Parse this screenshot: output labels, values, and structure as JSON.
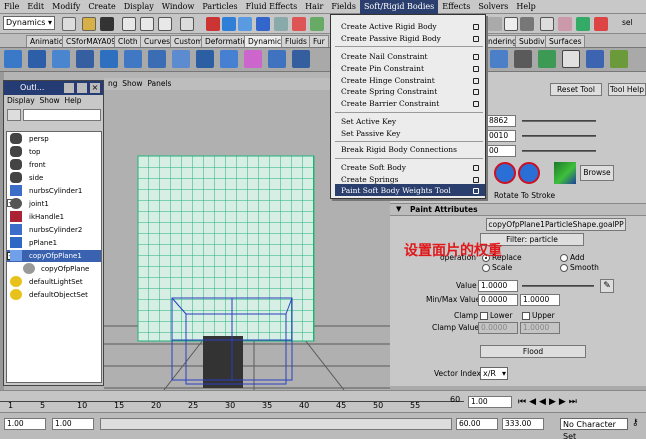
{
  "menubar": [
    "File",
    "Edit",
    "Modify",
    "Create",
    "Display",
    "Window",
    "Particles",
    "Fluid Effects",
    "Hair",
    "Fields",
    "Soft/Rigid Bodies",
    "Effects",
    "Solvers",
    "Help"
  ],
  "statusline": {
    "mode": "Dynamics",
    "sel_label": "sel"
  },
  "shelf_tabs": [
    "Animation",
    "CSforMAYA09",
    "Cloth",
    "Curves",
    "Custom",
    "Deformation",
    "Dynamics",
    "Fluids",
    "Fur",
    "ndering",
    "Subdivs",
    "Surfaces"
  ],
  "viewport": {
    "panel_menu": [
      "ng",
      "Show",
      "Panels"
    ]
  },
  "outliner": {
    "title": "Outl...",
    "menu": [
      "Display",
      "Show",
      "Help"
    ],
    "items": [
      {
        "label": "persp",
        "icon": "camera-icon"
      },
      {
        "label": "top",
        "icon": "camera-icon"
      },
      {
        "label": "front",
        "icon": "camera-icon"
      },
      {
        "label": "side",
        "icon": "camera-icon"
      },
      {
        "label": "nurbsCylinder1",
        "icon": "nurbs-icon"
      },
      {
        "label": "joint1",
        "icon": "joint-icon"
      },
      {
        "label": "ikHandle1",
        "icon": "ik-handle-icon"
      },
      {
        "label": "nurbsCylinder2",
        "icon": "nurbs-icon"
      },
      {
        "label": "pPlane1",
        "icon": "polygon-icon"
      },
      {
        "label": "copyOfpPlane1",
        "icon": "polygon-icon"
      },
      {
        "label": "copyOfpPlane",
        "icon": "particle-icon"
      },
      {
        "label": "defaultLightSet",
        "icon": "set-icon"
      },
      {
        "label": "defaultObjectSet",
        "icon": "set-icon"
      }
    ]
  },
  "dropdown_menu": {
    "items": [
      {
        "label": "Create Active Rigid Body",
        "option": true
      },
      {
        "label": "Create Passive Rigid Body",
        "option": true
      },
      {
        "label": "Create Nail Constraint",
        "option": true
      },
      {
        "label": "Create Pin Constraint",
        "option": true
      },
      {
        "label": "Create Hinge Constraint",
        "option": true
      },
      {
        "label": "Create Spring Constraint",
        "option": true
      },
      {
        "label": "Create Barrier Constraint",
        "option": true
      },
      {
        "label": "Set Active Key",
        "option": false
      },
      {
        "label": "Set Passive Key",
        "option": false
      },
      {
        "label": "Break Rigid Body Connections",
        "option": false
      },
      {
        "label": "Create Soft Body",
        "option": true
      },
      {
        "label": "Create Springs",
        "option": true
      },
      {
        "label": "Paint Soft Body Weights Tool",
        "option": true
      }
    ]
  },
  "tool_settings": {
    "reset_tool": "Reset Tool",
    "tool_help": "Tool Help",
    "values": [
      "8862",
      "0010",
      "00"
    ],
    "browse": "Browse",
    "rotate_to_stroke": "Rotate To Stroke"
  },
  "paint_attributes": {
    "header": "Paint Attributes",
    "shape_button": "copyOfpPlane1ParticleShape.goalPP",
    "filter_button": "Filter: particle",
    "operation_label": "operation",
    "ops": [
      "Replace",
      "Add",
      "Scale",
      "Smooth"
    ],
    "value_label": "Value",
    "value": "1.0000",
    "minmax_label": "Min/Max Value",
    "min": "0.0000",
    "max": "1.0000",
    "clamp_label": "Clamp",
    "lower": "Lower",
    "upper": "Upper",
    "clamp_values_label": "Clamp Values",
    "clamp_min": "0.0000",
    "clamp_max": "1.0000",
    "flood": "Flood",
    "vector_index_label": "Vector Index",
    "vector_index": "x/R"
  },
  "annotation": "设置面片的权重",
  "timeline": {
    "ticks": [
      "1",
      "5",
      "10",
      "15",
      "20",
      "25",
      "30",
      "35",
      "40",
      "45",
      "50",
      "55",
      "60"
    ],
    "current": "1.00"
  },
  "range": {
    "start": "1.00",
    "start2": "1.00",
    "end": "60.00",
    "end2": "333.00",
    "character_set": "No Character Set"
  }
}
